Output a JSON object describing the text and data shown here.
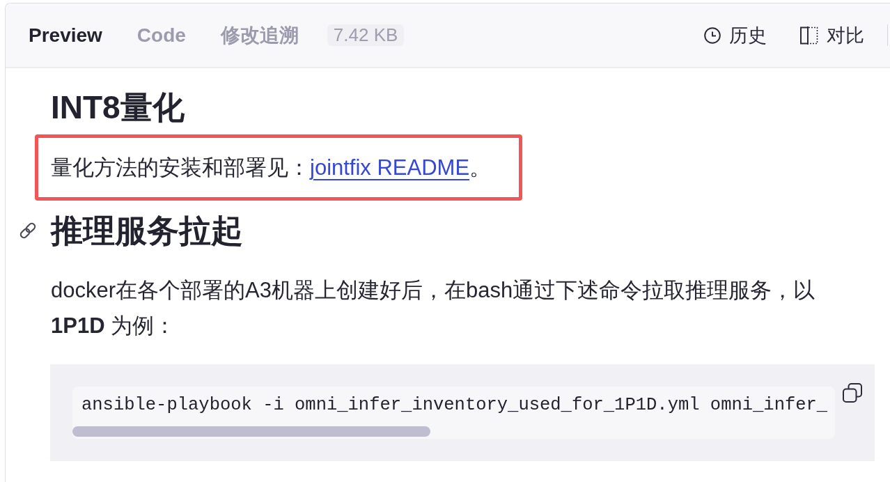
{
  "tabs": [
    {
      "label": "Preview",
      "selected": true
    },
    {
      "label": "Code",
      "selected": false
    },
    {
      "label": "修改追溯",
      "selected": false
    }
  ],
  "file_size": "7.42 KB",
  "actions": [
    {
      "kind": "history",
      "label": "历史"
    },
    {
      "kind": "compare",
      "label": "对比"
    }
  ],
  "content": [
    {
      "kind": "heading",
      "text": "INT8量化",
      "anchor": false
    },
    {
      "kind": "paragraph",
      "text": "量化方法的安装和部署见：",
      "link": "jointfix README",
      "text_after": "。",
      "highlighted": true
    },
    {
      "kind": "heading",
      "text": "推理服务拉起",
      "anchor": true
    },
    {
      "kind": "paragraph",
      "text": "docker在各个部署的A3机器上创建好后，在bash通过下述命令拉取推理服务，以 **1P1D** 为例：",
      "highlighted": false
    },
    {
      "kind": "code",
      "text": "ansible-playbook -i omni_infer_inventory_used_for_1P1D.yml omni_infer_"
    }
  ]
}
